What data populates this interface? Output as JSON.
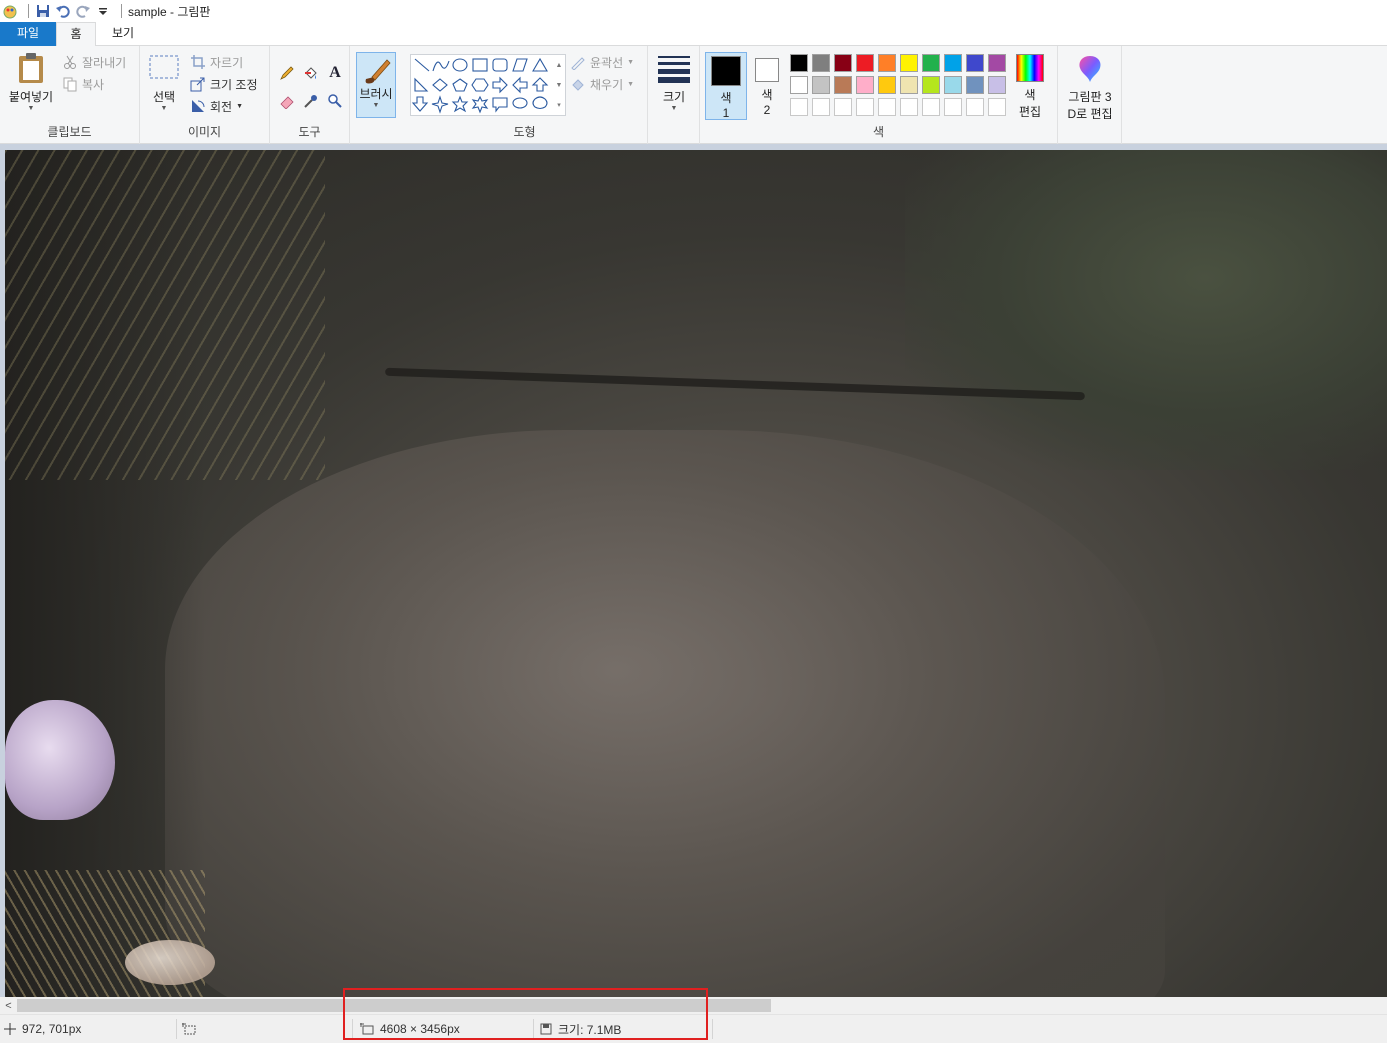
{
  "window": {
    "title": "sample - 그림판"
  },
  "tabs": {
    "file": "파일",
    "home": "홈",
    "view": "보기"
  },
  "ribbon": {
    "clipboard": {
      "paste": "붙여넣기",
      "cut": "잘라내기",
      "copy": "복사",
      "label": "클립보드"
    },
    "image": {
      "select": "선택",
      "crop": "자르기",
      "resize": "크기 조정",
      "rotate": "회전",
      "label": "이미지"
    },
    "tools": {
      "label": "도구"
    },
    "brush": {
      "label": "브러시"
    },
    "shapes": {
      "outline": "윤곽선",
      "fill": "채우기",
      "label": "도형"
    },
    "size": {
      "label": "크기"
    },
    "colors": {
      "color1": "색\n1",
      "color1_a": "색",
      "color1_b": "1",
      "color2_a": "색",
      "color2_b": "2",
      "edit_a": "색",
      "edit_b": "편집",
      "label": "색",
      "color1_value": "#000000",
      "color2_value": "#ffffff",
      "palette_row1": [
        "#000000",
        "#7f7f7f",
        "#880015",
        "#ed1c24",
        "#ff7f27",
        "#fff200",
        "#22b14c",
        "#00a2e8",
        "#3f48cc",
        "#a349a4"
      ],
      "palette_row2": [
        "#ffffff",
        "#c3c3c3",
        "#b97a57",
        "#ffaec9",
        "#ffc90e",
        "#efe4b0",
        "#b5e61d",
        "#99d9ea",
        "#7092be",
        "#c8bfe7"
      ],
      "palette_row3": [
        "#ffffff",
        "#ffffff",
        "#ffffff",
        "#ffffff",
        "#ffffff",
        "#ffffff",
        "#ffffff",
        "#ffffff",
        "#ffffff",
        "#ffffff"
      ]
    },
    "paint3d": {
      "line1": "그림판 3",
      "line2": "D로 편집"
    }
  },
  "status": {
    "cursor_pos": "972, 701px",
    "image_dims": "4608 × 3456px",
    "file_size": "크기: 7.1MB"
  },
  "scrollbar": {
    "thumb_fraction": 0.55
  }
}
